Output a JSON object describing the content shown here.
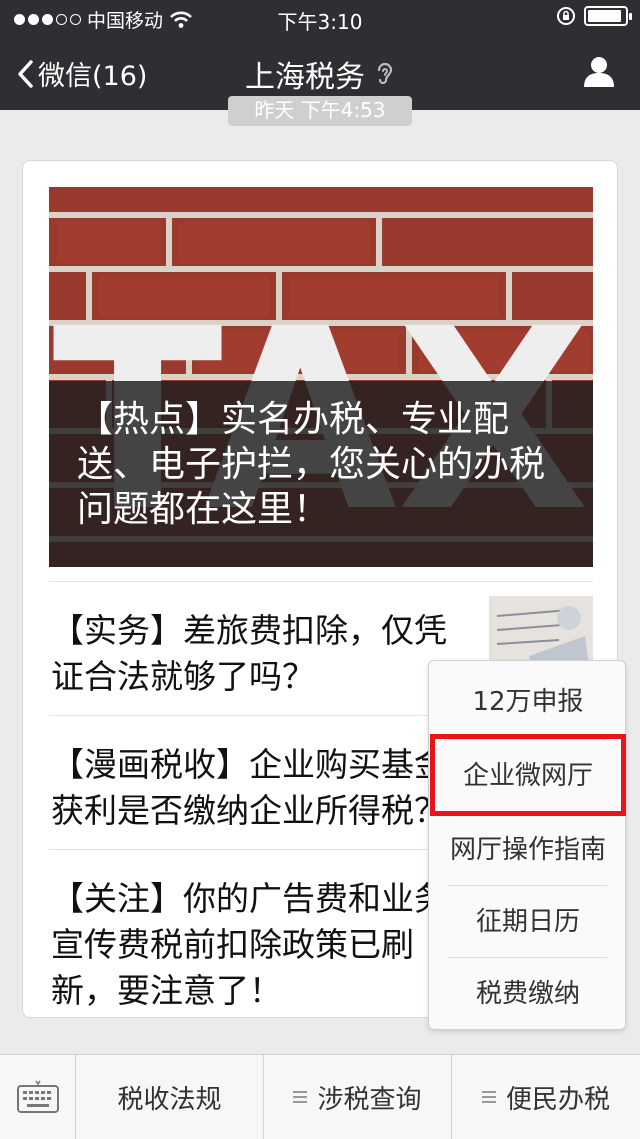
{
  "status_bar": {
    "carrier": "中国移动",
    "time": "下午3:10"
  },
  "nav": {
    "back_label": "微信(16)",
    "title": "上海税务"
  },
  "chat": {
    "timestamp": "昨天 下午4:53",
    "cover_article": {
      "image_word": "TAX",
      "title": "【热点】实名办税、专业配送、电子护拦，您关心的办税问题都在这里！"
    },
    "articles": [
      {
        "title": "【实务】差旅费扣除，仅凭证合法就够了吗？"
      },
      {
        "title": "【漫画税收】企业购买基金获利是否缴纳企业所得税？"
      },
      {
        "title": "【关注】你的广告费和业务宣传费税前扣除政策已刷新，要注意了！"
      }
    ]
  },
  "popup_menu": {
    "items": [
      "12万申报",
      "企业微网厅",
      "网厅操作指南",
      "征期日历",
      "税费缴纳"
    ],
    "highlighted_index": 1
  },
  "bottom_menu": {
    "items": [
      {
        "label": "税收法规",
        "has_submenu": false
      },
      {
        "label": "涉税查询",
        "has_submenu": true
      },
      {
        "label": "便民办税",
        "has_submenu": true
      }
    ]
  },
  "colors": {
    "nav_bg": "#2e2e33",
    "highlight": "#e8141b",
    "chat_bg": "#ebebeb"
  },
  "battery_level": 0.92
}
